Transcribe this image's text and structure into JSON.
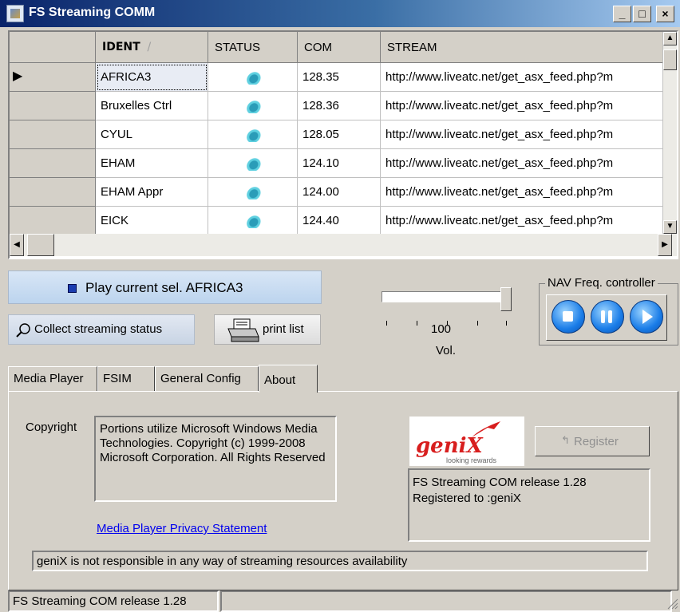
{
  "window": {
    "title": "FS Streaming COMM",
    "controls": {
      "minimize": "_",
      "maximize": "□",
      "close": "×"
    }
  },
  "grid": {
    "columns": [
      "IDENT",
      "STATUS",
      "COM",
      "STREAM"
    ],
    "sort_indicator": "/",
    "rows": [
      {
        "ident": "AFRICA3",
        "com": "128.35",
        "stream": "http://www.liveatc.net/get_asx_feed.php?m"
      },
      {
        "ident": "Bruxelles Ctrl",
        "com": "128.36",
        "stream": "http://www.liveatc.net/get_asx_feed.php?m"
      },
      {
        "ident": "CYUL",
        "com": "128.05",
        "stream": "http://www.liveatc.net/get_asx_feed.php?m"
      },
      {
        "ident": "EHAM",
        "com": "124.10",
        "stream": "http://www.liveatc.net/get_asx_feed.php?m"
      },
      {
        "ident": "EHAM Appr",
        "com": "124.00",
        "stream": "http://www.liveatc.net/get_asx_feed.php?m"
      },
      {
        "ident": "EICK",
        "com": "124.40",
        "stream": "http://www.liveatc.net/get_asx_feed.php?m"
      }
    ],
    "status_icon": "stream-status-icon",
    "selected_indicator": "▶"
  },
  "controls": {
    "play_label": "Play current sel. AFRICA3",
    "collect_label": "Collect streaming status",
    "print_label": "print list",
    "volume_value": "100",
    "volume_label": "Vol.",
    "volume_level": 1.0
  },
  "nav": {
    "legend": "NAV Freq. controller",
    "buttons": [
      "stop",
      "pause",
      "play"
    ]
  },
  "tabs": [
    "Media Player",
    "FSIM",
    "General Config",
    "About"
  ],
  "active_tab": "About",
  "about": {
    "copyright_label": "Copyright",
    "copyright_text": "Portions utilize Microsoft Windows Media Technologies.  Copyright (c) 1999-2008 Microsoft Corporation.  All Rights Reserved",
    "privacy_link": "Media Player Privacy Statement",
    "logo_text": "geniX",
    "logo_tagline": "looking rewards",
    "register_label": "Register",
    "release_line1": "FS Streaming COM release 1.28",
    "release_line2": "Registered to :geniX",
    "disclaimer": "geniX is not responsible in any way of streaming resources availability"
  },
  "statusbar": {
    "text": "FS Streaming COM release 1.28"
  },
  "colors": {
    "titlebar_start": "#0a246a",
    "titlebar_end": "#a6caf0",
    "link": "#0000ee",
    "face": "#d4d0c8"
  }
}
